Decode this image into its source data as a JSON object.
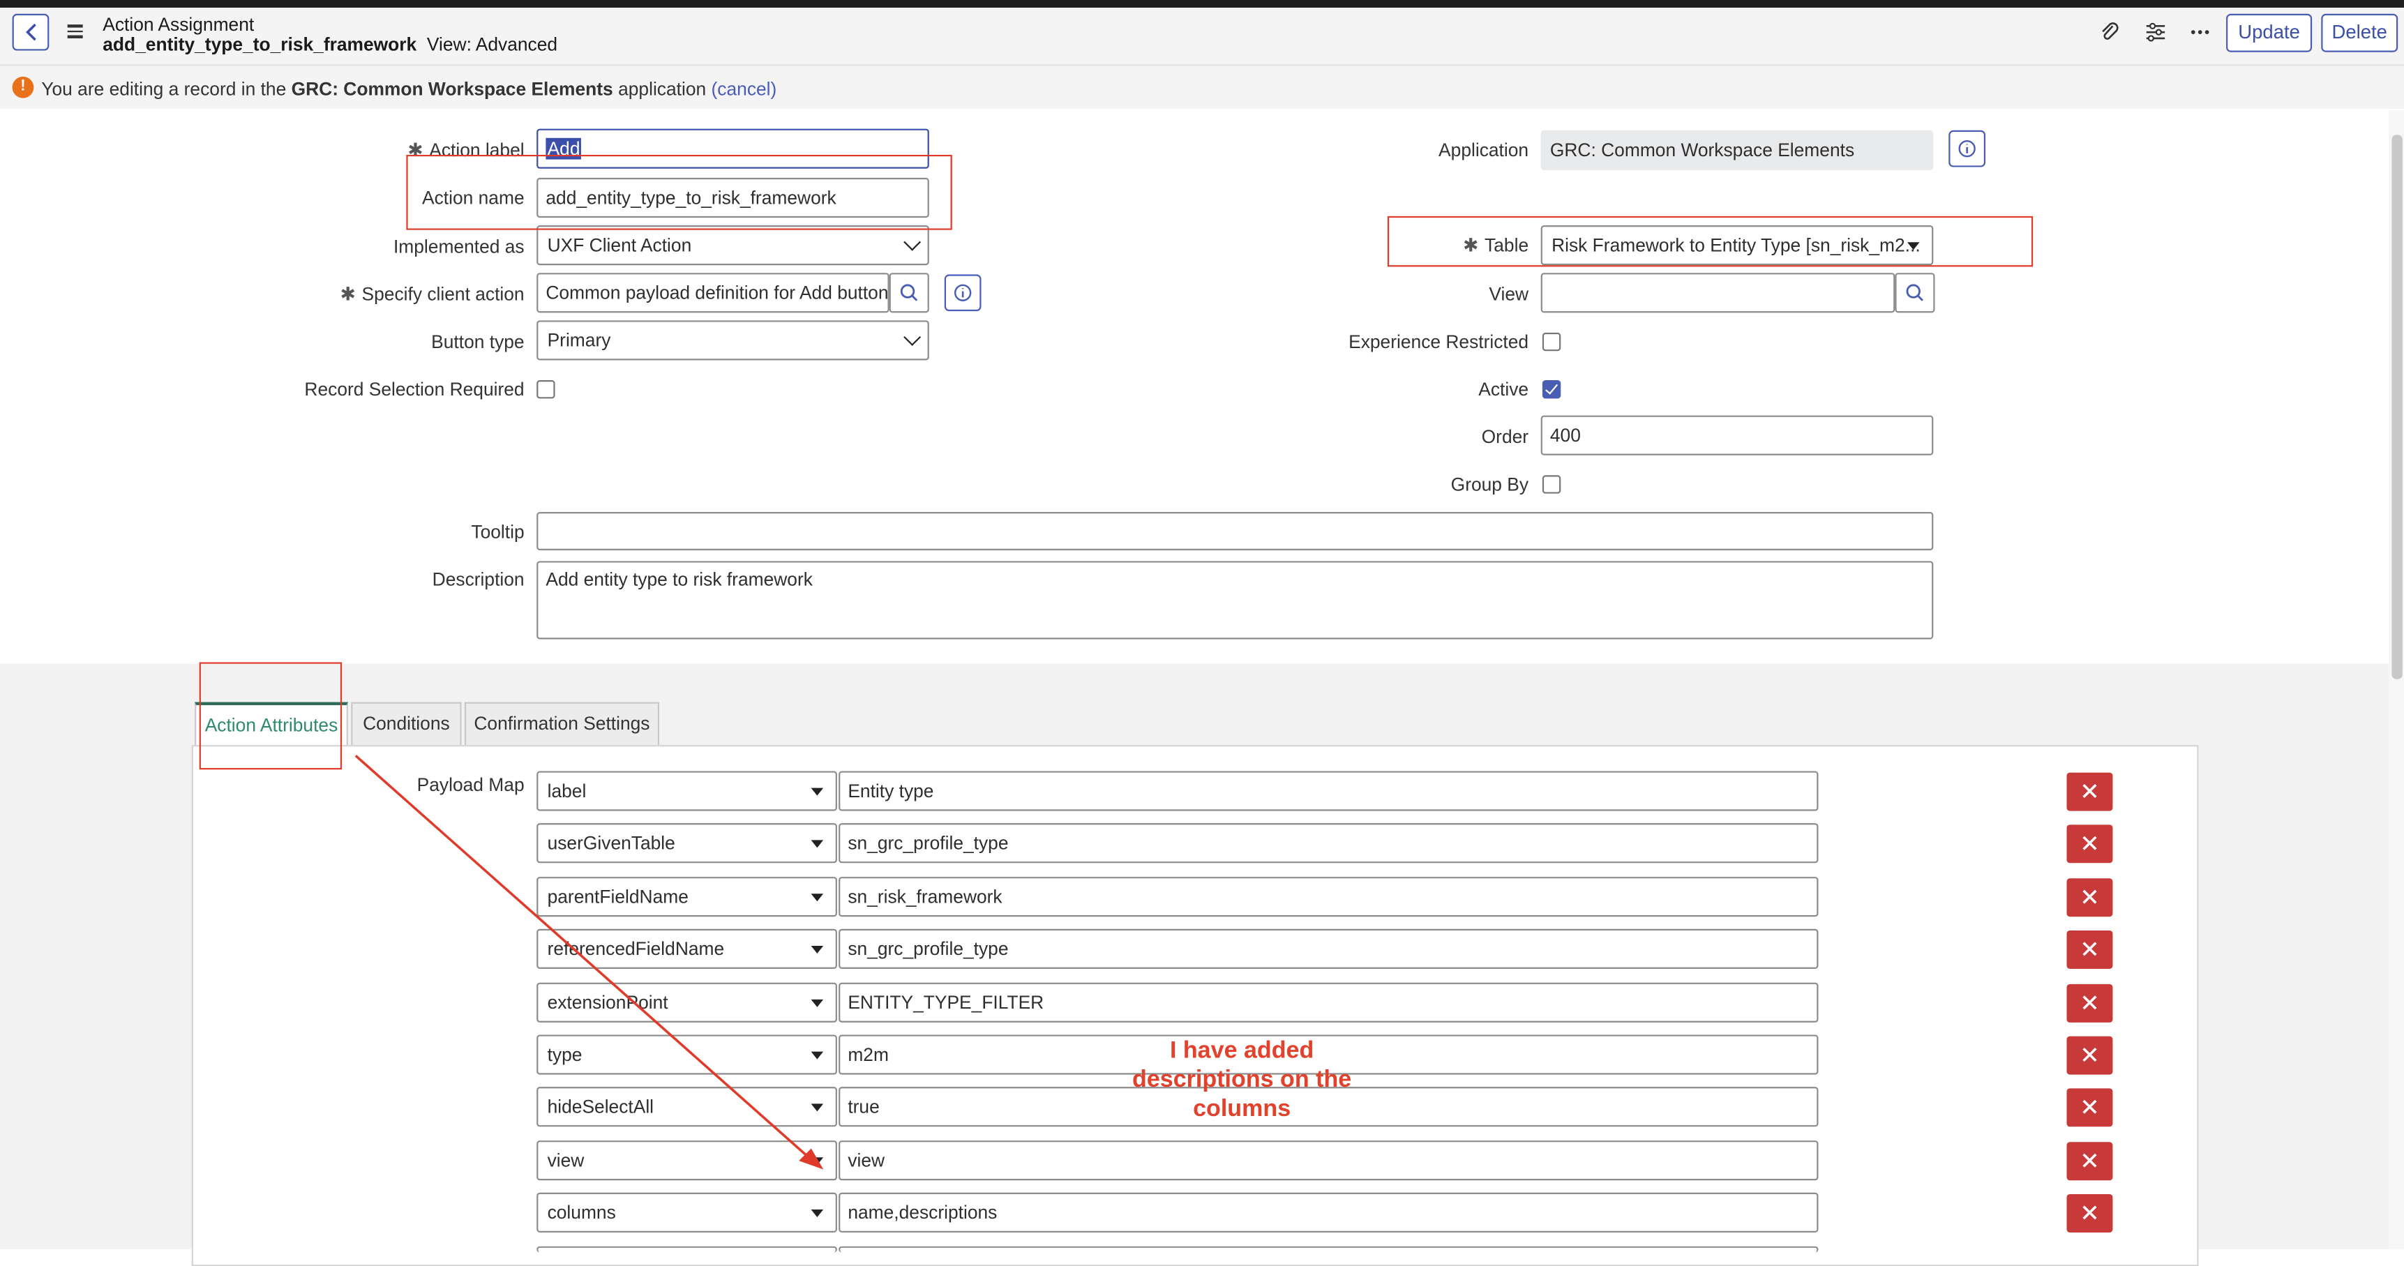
{
  "header": {
    "record_type": "Action Assignment",
    "record_name": "add_entity_type_to_risk_framework",
    "view_label": "View: Advanced",
    "update_label": "Update",
    "delete_label": "Delete"
  },
  "notice": {
    "prefix": "You are editing a record in the",
    "app_name": "GRC: Common Workspace Elements",
    "suffix": "application",
    "cancel_label": "(cancel)"
  },
  "form": {
    "action_label": {
      "label": "Action label",
      "value": "Add"
    },
    "action_name": {
      "label": "Action name",
      "value": "add_entity_type_to_risk_framework"
    },
    "implemented_as": {
      "label": "Implemented as",
      "value": "UXF Client Action"
    },
    "client_action": {
      "label": "Specify client action",
      "value": "Common payload definition for Add buttons"
    },
    "button_type": {
      "label": "Button type",
      "value": "Primary"
    },
    "record_selection": {
      "label": "Record Selection Required",
      "checked": false
    },
    "application": {
      "label": "Application",
      "value": "GRC: Common Workspace Elements"
    },
    "table": {
      "label": "Table",
      "value": "Risk Framework to Entity Type [sn_risk_m2..."
    },
    "view": {
      "label": "View",
      "value": ""
    },
    "experience_restricted": {
      "label": "Experience Restricted",
      "checked": false
    },
    "active": {
      "label": "Active",
      "checked": true
    },
    "order": {
      "label": "Order",
      "value": "400"
    },
    "group_by": {
      "label": "Group By",
      "checked": false
    },
    "tooltip": {
      "label": "Tooltip",
      "value": ""
    },
    "description": {
      "label": "Description",
      "value": "Add entity type to risk framework"
    }
  },
  "tabs": [
    {
      "label": "Action Attributes",
      "active": true
    },
    {
      "label": "Conditions",
      "active": false
    },
    {
      "label": "Confirmation Settings",
      "active": false
    }
  ],
  "payload": {
    "label": "Payload Map",
    "rows": [
      {
        "key": "label",
        "value": "Entity type"
      },
      {
        "key": "userGivenTable",
        "value": "sn_grc_profile_type"
      },
      {
        "key": "parentFieldName",
        "value": "sn_risk_framework"
      },
      {
        "key": "referencedFieldName",
        "value": "sn_grc_profile_type"
      },
      {
        "key": "extensionPoint",
        "value": "ENTITY_TYPE_FILTER"
      },
      {
        "key": "type",
        "value": "m2m"
      },
      {
        "key": "hideSelectAll",
        "value": "true"
      },
      {
        "key": "view",
        "value": "view"
      },
      {
        "key": "columns",
        "value": "name,descriptions"
      }
    ]
  },
  "annotation": {
    "line1": "I have added",
    "line2": "descriptions on the",
    "line3": "columns",
    "color": "#e2412c"
  },
  "colors": {
    "accent": "#4a5db4",
    "danger": "#c83a3a",
    "warning": "#e7721b",
    "annotation_red": "#e03a2a"
  }
}
